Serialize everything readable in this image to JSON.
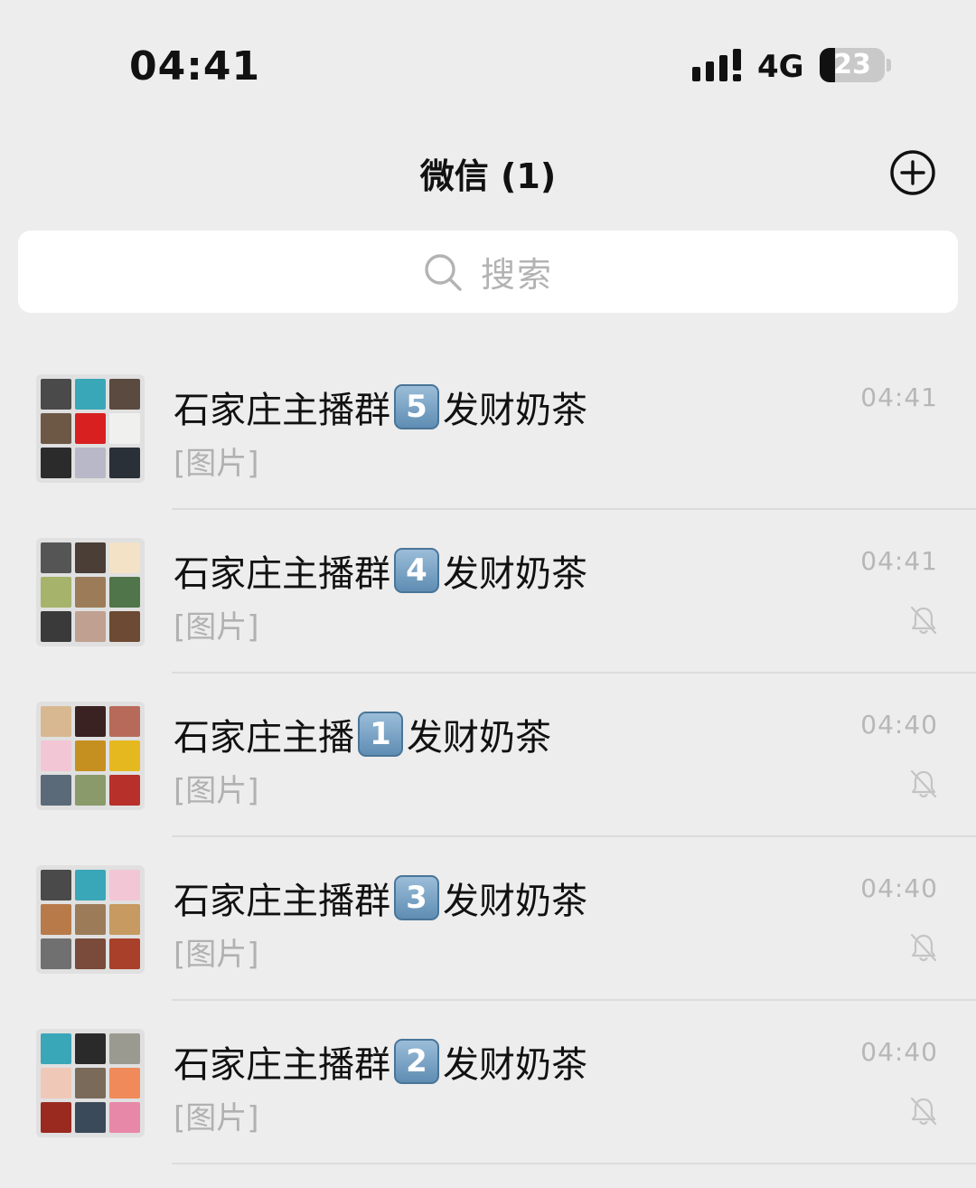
{
  "status_bar": {
    "time": "04:41",
    "network": "4G",
    "battery": "23",
    "battery_level_percent": 23
  },
  "header": {
    "title": "微信 (1)",
    "add_icon": "plus-circle-icon"
  },
  "search": {
    "placeholder": "搜索",
    "icon": "search-icon"
  },
  "chats": [
    {
      "name_prefix": "石家庄主播群",
      "badge": "5",
      "name_suffix": "发财奶茶",
      "preview": "[图片]",
      "time": "04:41",
      "muted": false,
      "avatar_colors": [
        "#4a4a4a",
        "#3aa7b8",
        "#5a4a40",
        "#6d5846",
        "#d92020",
        "#f0f0ee",
        "#2b2b2b",
        "#b8b8c8",
        "#2a3038"
      ]
    },
    {
      "name_prefix": "石家庄主播群",
      "badge": "4",
      "name_suffix": "发财奶茶",
      "preview": "[图片]",
      "time": "04:41",
      "muted": true,
      "avatar_colors": [
        "#555555",
        "#4a3e36",
        "#f3e2c6",
        "#a6b36a",
        "#9c7c58",
        "#50754a",
        "#3a3a3a",
        "#c0a090",
        "#6c4a33"
      ]
    },
    {
      "name_prefix": "石家庄主播",
      "badge": "1",
      "name_suffix": "发财奶茶",
      "preview": "[图片]",
      "time": "04:40",
      "muted": true,
      "avatar_colors": [
        "#d8b890",
        "#3a2222",
        "#b86a5a",
        "#f3c6d6",
        "#c69020",
        "#e6b820",
        "#5a6a78",
        "#8a9a6a",
        "#b8302a"
      ]
    },
    {
      "name_prefix": "石家庄主播群",
      "badge": "3",
      "name_suffix": "发财奶茶",
      "preview": "[图片]",
      "time": "04:40",
      "muted": true,
      "avatar_colors": [
        "#4a4a4a",
        "#3aa7b8",
        "#f3c6d6",
        "#b87a48",
        "#9c7c58",
        "#c69a60",
        "#707070",
        "#7a4a3a",
        "#a8402a"
      ]
    },
    {
      "name_prefix": "石家庄主播群",
      "badge": "2",
      "name_suffix": "发财奶茶",
      "preview": "[图片]",
      "time": "04:40",
      "muted": true,
      "avatar_colors": [
        "#3aa7b8",
        "#2a2a2a",
        "#9a9a90",
        "#f0c8b8",
        "#7a6a5a",
        "#f08a5a",
        "#9a2a20",
        "#3a4a5a",
        "#e888a8"
      ]
    }
  ]
}
